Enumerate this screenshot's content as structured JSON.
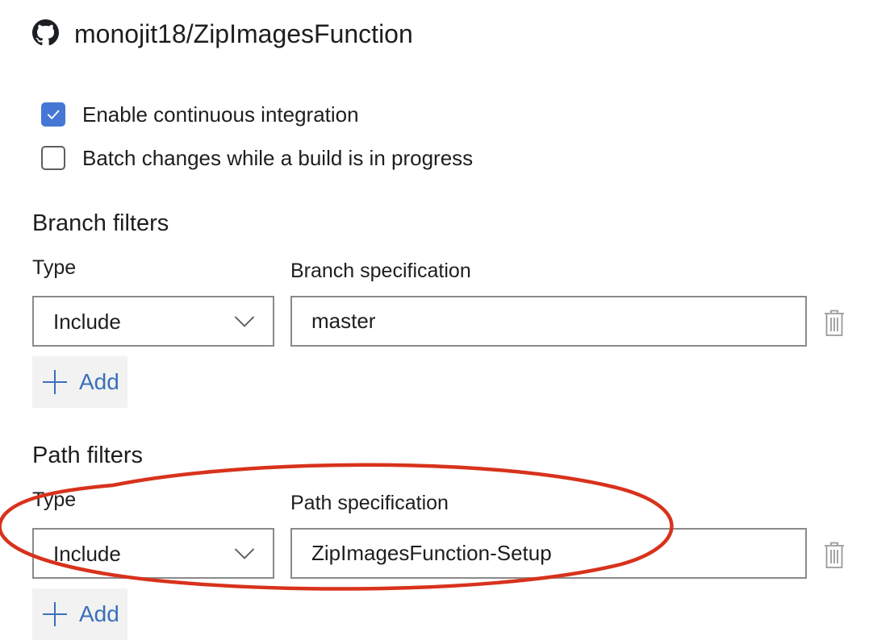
{
  "repository": {
    "name": "monojit18/ZipImagesFunction",
    "icon": "github-icon"
  },
  "options": [
    {
      "label": "Enable continuous integration",
      "checked": true
    },
    {
      "label": "Batch changes while a build is in progress",
      "checked": false
    }
  ],
  "branch_filters": {
    "title": "Branch filters",
    "type_label": "Type",
    "spec_label": "Branch specification",
    "type_value": "Include",
    "spec_value": "master",
    "add_label": "Add"
  },
  "path_filters": {
    "title": "Path filters",
    "type_label": "Type",
    "spec_label": "Path specification",
    "type_value": "Include",
    "spec_value": "ZipImagesFunction-Setup",
    "add_label": "Add"
  },
  "colors": {
    "accent": "#4578d4",
    "link": "#3b6fb9",
    "annotation": "#d8321c",
    "button_bg": "#f2f2f2",
    "border": "#8a8a8a"
  }
}
